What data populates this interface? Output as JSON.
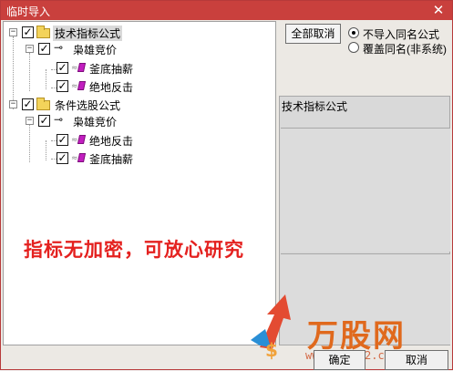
{
  "window": {
    "title": "临时导入",
    "close_glyph": "✕"
  },
  "tree": {
    "groups": [
      {
        "label": "技术指标公式",
        "expander": "−",
        "checked": "✓",
        "selected": true,
        "sub": {
          "label": "枭雄竞价",
          "expander": "−",
          "checked": "✓",
          "items": [
            {
              "label": "釜底抽薪",
              "checked": "✓"
            },
            {
              "label": "绝地反击",
              "checked": "✓"
            }
          ]
        }
      },
      {
        "label": "条件选股公式",
        "expander": "−",
        "checked": "✓",
        "selected": false,
        "sub": {
          "label": "枭雄竞价",
          "expander": "−",
          "checked": "✓",
          "items": [
            {
              "label": "绝地反击",
              "checked": "✓"
            },
            {
              "label": "釜底抽薪",
              "checked": "✓"
            }
          ]
        }
      }
    ],
    "formula_prefix": "≈"
  },
  "overlay_text": "指标无加密，可放心研究",
  "controls": {
    "cancel_all_label": "全部取消",
    "radio_options": [
      {
        "label": "不导入同名公式",
        "selected": true
      },
      {
        "label": "覆盖同名(非系统)",
        "selected": false
      }
    ]
  },
  "info": {
    "title": "技术指标公式"
  },
  "buttons": {
    "ok": "确定",
    "cancel": "取消"
  },
  "watermark": {
    "brand": "万股网",
    "url": "www.201082.com"
  },
  "colors": {
    "title_bar": "#c9403d",
    "overlay_red": "#e4211f",
    "brand_orange": "#e0691d",
    "formula_magenta": "#c21ec0",
    "folder_yellow": "#f3d35a"
  }
}
